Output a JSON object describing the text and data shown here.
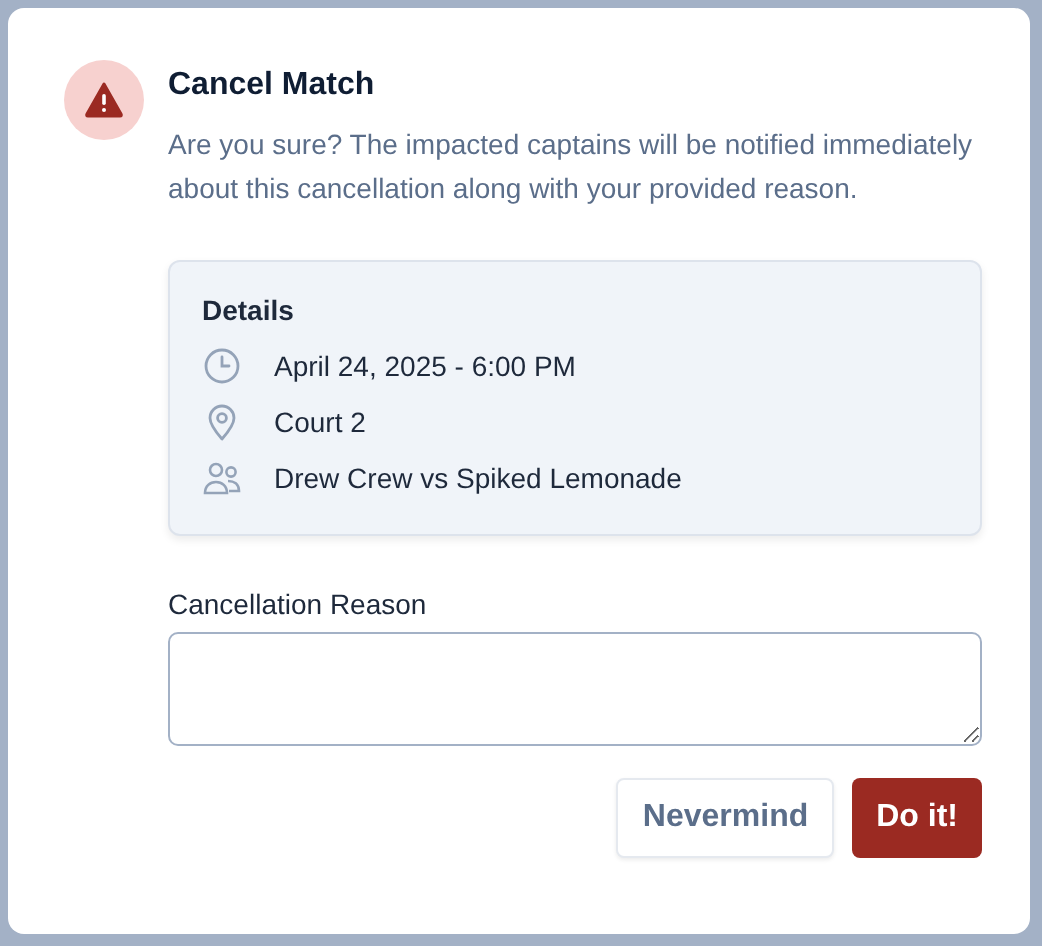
{
  "dialog": {
    "title": "Cancel Match",
    "message": "Are you sure? The impacted captains will be notified immediately about this cancellation along with your provided reason."
  },
  "details": {
    "heading": "Details",
    "items": [
      {
        "kind": "time",
        "text": "April 24, 2025 - 6:00 PM"
      },
      {
        "kind": "location",
        "text": "Court 2"
      },
      {
        "kind": "teams",
        "text": "Drew Crew vs Spiked Lemonade"
      }
    ]
  },
  "reason": {
    "label": "Cancellation Reason"
  },
  "buttons": [
    {
      "kind": "secondary",
      "label": "Nevermind"
    },
    {
      "kind": "danger",
      "label": "Do it!"
    }
  ]
}
